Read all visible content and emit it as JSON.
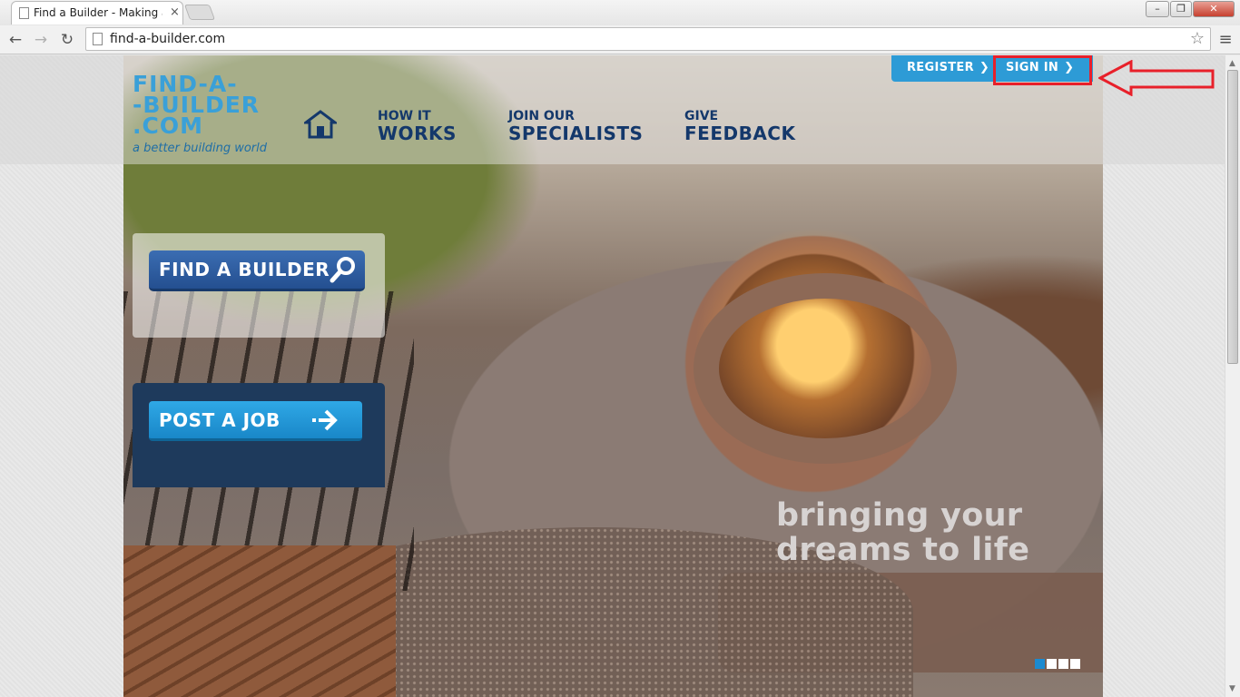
{
  "browser": {
    "tab_title": "Find a Builder - Making a l",
    "tab_close": "×",
    "url": "find-a-builder.com",
    "window_min": "–",
    "window_max": "❐",
    "window_close": "✕",
    "nav_back": "←",
    "nav_forward": "→",
    "nav_reload": "↻",
    "bookmark_star": "☆",
    "menu": "≡"
  },
  "site": {
    "logo_lines": [
      "FIND-A-",
      "-BUILDER",
      ".COM"
    ],
    "logo_tagline": "a better building world",
    "nav": [
      {
        "small": "HOW IT",
        "big": "WORKS"
      },
      {
        "small": "JOIN OUR",
        "big": "SPECIALISTS"
      },
      {
        "small": "GIVE",
        "big": "FEEDBACK"
      }
    ],
    "auth": {
      "register": "REGISTER",
      "sign_in": "SIGN IN",
      "chevron": "❯"
    },
    "cta": {
      "find": "FIND A BUILDER",
      "post": "POST A JOB"
    },
    "hero_tagline": [
      "bringing your",
      "dreams to life"
    ],
    "slider": {
      "count": 4,
      "active": 0
    }
  },
  "colors": {
    "brand_blue": "#2d9bd6",
    "nav_navy": "#14386b",
    "annotation_red": "#e8202a"
  },
  "icons": [
    "home-icon",
    "magnifier-icon",
    "arrow-right-icon",
    "chevron-right-icon",
    "star-icon",
    "menu-icon"
  ]
}
